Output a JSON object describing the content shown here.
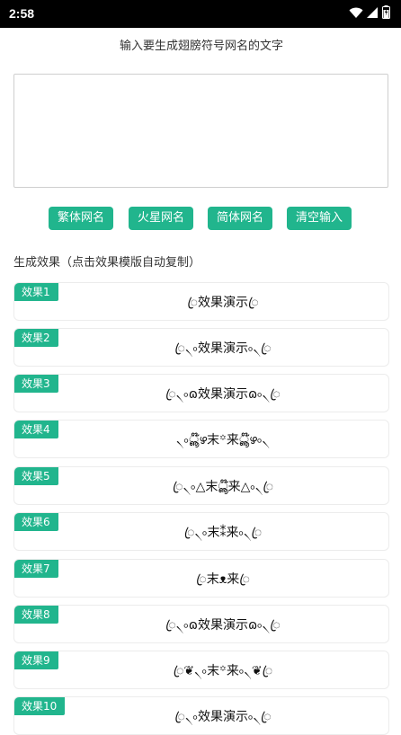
{
  "status_bar": {
    "time": "2:58"
  },
  "page": {
    "prompt_label": "输入要生成翅膀符号网名的文字",
    "input_value": "",
    "buttons": [
      "繁体网名",
      "火星网名",
      "简体网名",
      "清空输入"
    ],
    "section_title": "生成效果（点击效果模版自动复制）",
    "results": [
      {
        "label": "效果1",
        "text": "ꦿ效果演示ꦿ"
      },
      {
        "label": "效果2",
        "text": "ꦿ৲৹效果演示৹৲ꦿ"
      },
      {
        "label": "效果3",
        "text": "ꦿ৲৹ɷ效果演示ɷ৹৲ꦿ"
      },
      {
        "label": "效果4",
        "text": "৲৹ൣ໊ഴ末꙳来ൣ໊ഴ৹৲"
      },
      {
        "label": "效果5",
        "text": "ꦿ৲৹△末ൣ໊来△৹৲ꦿ"
      },
      {
        "label": "效果6",
        "text": "ꦿ৲৹末⁑来৹৲ꦿ"
      },
      {
        "label": "效果7",
        "text": "ꦿ末ᴥ来ꦿ"
      },
      {
        "label": "效果8",
        "text": "ꦿ৲৹ɷ效果演示ɷ৹৲ꦿ"
      },
      {
        "label": "效果9",
        "text": "ꦿ❦৲৹末꙳来৹৲❦ꦿ"
      },
      {
        "label": "效果10",
        "text": "ꦿ৲৹效果演示৹৲ꦿ"
      }
    ]
  },
  "colors": {
    "accent": "#21b58d",
    "status_bar": "#000000"
  }
}
